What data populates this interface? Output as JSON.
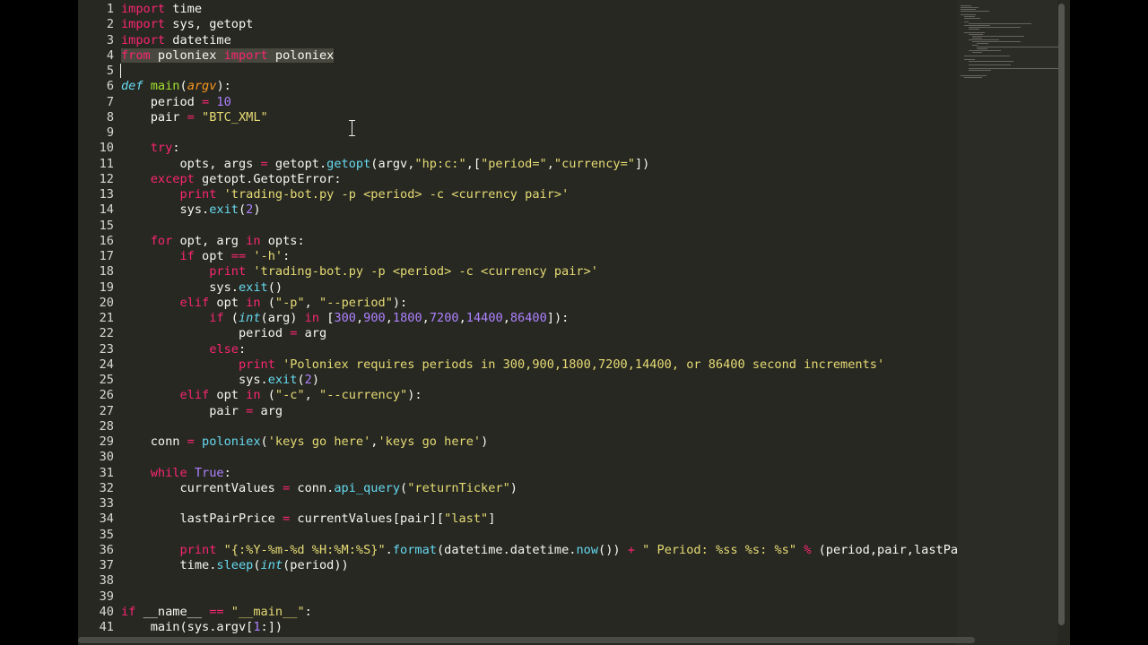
{
  "editor": {
    "theme_colors": {
      "background": "#272822",
      "keyword": "#f92672",
      "function": "#66d9ef",
      "string": "#e6db74",
      "number": "#ae81ff",
      "definition": "#a6e22e",
      "argument": "#fd971f",
      "text": "#f8f8f2"
    },
    "lines": [
      {
        "n": "1",
        "tokens": [
          [
            "kw",
            "import"
          ],
          [
            "pl",
            " time"
          ]
        ]
      },
      {
        "n": "2",
        "tokens": [
          [
            "kw",
            "import"
          ],
          [
            "pl",
            " sys, getopt"
          ]
        ]
      },
      {
        "n": "3",
        "tokens": [
          [
            "kw",
            "import"
          ],
          [
            "pl",
            " datetime"
          ]
        ]
      },
      {
        "n": "4",
        "selected": true,
        "tokens": [
          [
            "kw",
            "from"
          ],
          [
            "pl",
            " poloniex "
          ],
          [
            "kw",
            "import"
          ],
          [
            "pl",
            " poloniex"
          ]
        ]
      },
      {
        "n": "5",
        "tokens": []
      },
      {
        "n": "6",
        "tokens": [
          [
            "de",
            "def"
          ],
          [
            "pl",
            " "
          ],
          [
            "df",
            "main"
          ],
          [
            "pl",
            "("
          ],
          [
            "ar",
            "argv"
          ],
          [
            "pl",
            "):"
          ]
        ]
      },
      {
        "n": "7",
        "tokens": [
          [
            "pl",
            "    period "
          ],
          [
            "kw",
            "="
          ],
          [
            "pl",
            " "
          ],
          [
            "nu",
            "10"
          ]
        ]
      },
      {
        "n": "8",
        "tokens": [
          [
            "pl",
            "    pair "
          ],
          [
            "kw",
            "="
          ],
          [
            "pl",
            " "
          ],
          [
            "st",
            "\"BTC_XML\""
          ]
        ]
      },
      {
        "n": "9",
        "tokens": []
      },
      {
        "n": "10",
        "tokens": [
          [
            "pl",
            "    "
          ],
          [
            "kw",
            "try"
          ],
          [
            "pl",
            ":"
          ]
        ]
      },
      {
        "n": "11",
        "tokens": [
          [
            "pl",
            "        opts, args "
          ],
          [
            "kw",
            "="
          ],
          [
            "pl",
            " getopt."
          ],
          [
            "fn",
            "getopt"
          ],
          [
            "pl",
            "(argv,"
          ],
          [
            "st",
            "\"hp:c:\""
          ],
          [
            "pl",
            ",["
          ],
          [
            "st",
            "\"period=\""
          ],
          [
            "pl",
            ","
          ],
          [
            "st",
            "\"currency=\""
          ],
          [
            "pl",
            "])"
          ]
        ]
      },
      {
        "n": "12",
        "tokens": [
          [
            "pl",
            "    "
          ],
          [
            "kw",
            "except"
          ],
          [
            "pl",
            " getopt.GetoptError:"
          ]
        ]
      },
      {
        "n": "13",
        "tokens": [
          [
            "pl",
            "        "
          ],
          [
            "kw",
            "print"
          ],
          [
            "pl",
            " "
          ],
          [
            "st",
            "'trading-bot.py -p <period> -c <currency pair>'"
          ]
        ]
      },
      {
        "n": "14",
        "tokens": [
          [
            "pl",
            "        sys."
          ],
          [
            "fn",
            "exit"
          ],
          [
            "pl",
            "("
          ],
          [
            "nu",
            "2"
          ],
          [
            "pl",
            ")"
          ]
        ]
      },
      {
        "n": "15",
        "tokens": []
      },
      {
        "n": "16",
        "tokens": [
          [
            "pl",
            "    "
          ],
          [
            "kw",
            "for"
          ],
          [
            "pl",
            " opt, arg "
          ],
          [
            "kw",
            "in"
          ],
          [
            "pl",
            " opts:"
          ]
        ]
      },
      {
        "n": "17",
        "tokens": [
          [
            "pl",
            "        "
          ],
          [
            "kw",
            "if"
          ],
          [
            "pl",
            " opt "
          ],
          [
            "kw",
            "=="
          ],
          [
            "pl",
            " "
          ],
          [
            "st",
            "'-h'"
          ],
          [
            "pl",
            ":"
          ]
        ]
      },
      {
        "n": "18",
        "tokens": [
          [
            "pl",
            "            "
          ],
          [
            "kw",
            "print"
          ],
          [
            "pl",
            " "
          ],
          [
            "st",
            "'trading-bot.py -p <period> -c <currency pair>'"
          ]
        ]
      },
      {
        "n": "19",
        "tokens": [
          [
            "pl",
            "            sys."
          ],
          [
            "fn",
            "exit"
          ],
          [
            "pl",
            "()"
          ]
        ]
      },
      {
        "n": "20",
        "tokens": [
          [
            "pl",
            "        "
          ],
          [
            "kw",
            "elif"
          ],
          [
            "pl",
            " opt "
          ],
          [
            "kw",
            "in"
          ],
          [
            "pl",
            " ("
          ],
          [
            "st",
            "\"-p\""
          ],
          [
            "pl",
            ", "
          ],
          [
            "st",
            "\"--period\""
          ],
          [
            "pl",
            "):"
          ]
        ]
      },
      {
        "n": "21",
        "tokens": [
          [
            "pl",
            "            "
          ],
          [
            "kw",
            "if"
          ],
          [
            "pl",
            " ("
          ],
          [
            "bi",
            "int"
          ],
          [
            "pl",
            "(arg) "
          ],
          [
            "kw",
            "in"
          ],
          [
            "pl",
            " ["
          ],
          [
            "nu",
            "300"
          ],
          [
            "pl",
            ","
          ],
          [
            "nu",
            "900"
          ],
          [
            "pl",
            ","
          ],
          [
            "nu",
            "1800"
          ],
          [
            "pl",
            ","
          ],
          [
            "nu",
            "7200"
          ],
          [
            "pl",
            ","
          ],
          [
            "nu",
            "14400"
          ],
          [
            "pl",
            ","
          ],
          [
            "nu",
            "86400"
          ],
          [
            "pl",
            "]):"
          ]
        ]
      },
      {
        "n": "22",
        "tokens": [
          [
            "pl",
            "                period "
          ],
          [
            "kw",
            "="
          ],
          [
            "pl",
            " arg"
          ]
        ]
      },
      {
        "n": "23",
        "tokens": [
          [
            "pl",
            "            "
          ],
          [
            "kw",
            "else"
          ],
          [
            "pl",
            ":"
          ]
        ]
      },
      {
        "n": "24",
        "tokens": [
          [
            "pl",
            "                "
          ],
          [
            "kw",
            "print"
          ],
          [
            "pl",
            " "
          ],
          [
            "st",
            "'Poloniex requires periods in 300,900,1800,7200,14400, or 86400 second increments'"
          ]
        ]
      },
      {
        "n": "25",
        "tokens": [
          [
            "pl",
            "                sys."
          ],
          [
            "fn",
            "exit"
          ],
          [
            "pl",
            "("
          ],
          [
            "nu",
            "2"
          ],
          [
            "pl",
            ")"
          ]
        ]
      },
      {
        "n": "26",
        "tokens": [
          [
            "pl",
            "        "
          ],
          [
            "kw",
            "elif"
          ],
          [
            "pl",
            " opt "
          ],
          [
            "kw",
            "in"
          ],
          [
            "pl",
            " ("
          ],
          [
            "st",
            "\"-c\""
          ],
          [
            "pl",
            ", "
          ],
          [
            "st",
            "\"--currency\""
          ],
          [
            "pl",
            "):"
          ]
        ]
      },
      {
        "n": "27",
        "tokens": [
          [
            "pl",
            "            pair "
          ],
          [
            "kw",
            "="
          ],
          [
            "pl",
            " arg"
          ]
        ]
      },
      {
        "n": "28",
        "tokens": []
      },
      {
        "n": "29",
        "tokens": [
          [
            "pl",
            "    conn "
          ],
          [
            "kw",
            "="
          ],
          [
            "pl",
            " "
          ],
          [
            "fn",
            "poloniex"
          ],
          [
            "pl",
            "("
          ],
          [
            "st",
            "'keys go here'"
          ],
          [
            "pl",
            ","
          ],
          [
            "st",
            "'keys go here'"
          ],
          [
            "pl",
            ")"
          ]
        ]
      },
      {
        "n": "30",
        "tokens": []
      },
      {
        "n": "31",
        "tokens": [
          [
            "pl",
            "    "
          ],
          [
            "kw",
            "while"
          ],
          [
            "pl",
            " "
          ],
          [
            "co",
            "True"
          ],
          [
            "pl",
            ":"
          ]
        ]
      },
      {
        "n": "32",
        "tokens": [
          [
            "pl",
            "        currentValues "
          ],
          [
            "kw",
            "="
          ],
          [
            "pl",
            " conn."
          ],
          [
            "fn",
            "api_query"
          ],
          [
            "pl",
            "("
          ],
          [
            "st",
            "\"returnTicker\""
          ],
          [
            "pl",
            ")"
          ]
        ]
      },
      {
        "n": "33",
        "tokens": []
      },
      {
        "n": "34",
        "tokens": [
          [
            "pl",
            "        lastPairPrice "
          ],
          [
            "kw",
            "="
          ],
          [
            "pl",
            " currentValues[pair]["
          ],
          [
            "st",
            "\"last\""
          ],
          [
            "pl",
            "]"
          ]
        ]
      },
      {
        "n": "35",
        "tokens": []
      },
      {
        "n": "36",
        "tokens": [
          [
            "pl",
            "        "
          ],
          [
            "kw",
            "print"
          ],
          [
            "pl",
            " "
          ],
          [
            "st",
            "\"{:%Y-%m-%d %H:%M:%S}\""
          ],
          [
            "pl",
            "."
          ],
          [
            "fn",
            "format"
          ],
          [
            "pl",
            "(datetime.datetime."
          ],
          [
            "fn",
            "now"
          ],
          [
            "pl",
            "()) "
          ],
          [
            "kw",
            "+"
          ],
          [
            "pl",
            " "
          ],
          [
            "st",
            "\" Period: %ss %s: %s\""
          ],
          [
            "pl",
            " "
          ],
          [
            "kw",
            "%"
          ],
          [
            "pl",
            " (period,pair,lastPairPrice)"
          ]
        ]
      },
      {
        "n": "37",
        "tokens": [
          [
            "pl",
            "        time."
          ],
          [
            "fn",
            "sleep"
          ],
          [
            "pl",
            "("
          ],
          [
            "bi",
            "int"
          ],
          [
            "pl",
            "(period))"
          ]
        ]
      },
      {
        "n": "38",
        "tokens": []
      },
      {
        "n": "39",
        "tokens": []
      },
      {
        "n": "40",
        "tokens": [
          [
            "kw",
            "if"
          ],
          [
            "pl",
            " __name__ "
          ],
          [
            "kw",
            "=="
          ],
          [
            "pl",
            " "
          ],
          [
            "st",
            "\"__main__\""
          ],
          [
            "pl",
            ":"
          ]
        ]
      },
      {
        "n": "41",
        "tokens": [
          [
            "pl",
            "    main(sys.argv["
          ],
          [
            "nu",
            "1"
          ],
          [
            "pl",
            ":])"
          ]
        ]
      }
    ]
  }
}
